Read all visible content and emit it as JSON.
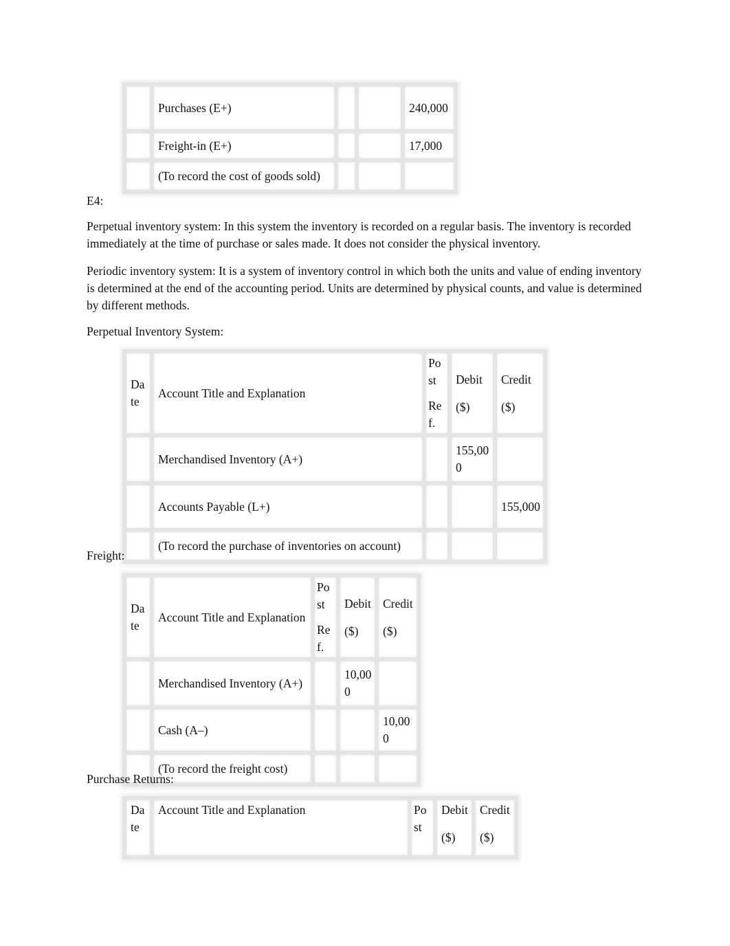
{
  "table_top": {
    "rows": [
      {
        "date": "",
        "account": "Purchases (E+)",
        "post_ref": "",
        "debit": "",
        "credit": "240,000"
      },
      {
        "date": "",
        "account": "Freight-in (E+)",
        "post_ref": "",
        "debit": "",
        "credit": "17,000"
      },
      {
        "date": "",
        "account": "(To record the cost of goods sold)",
        "post_ref": "",
        "debit": "",
        "credit": ""
      }
    ]
  },
  "e4_label": "E4:",
  "para_perpetual": "Perpetual inventory system: In this system the inventory is recorded on a regular basis. The inventory is recorded immediately at the time of purchase or sales made. It does not consider the physical inventory.",
  "para_periodic": "Periodic inventory system: It is a system of inventory control in which both the units and value of ending inventory is determined at the end of the accounting period. Units are determined by physical counts, and value is determined by different methods.",
  "perpetual_heading": "Perpetual Inventory System:",
  "headers": {
    "date": "Date",
    "account": "Account Title and Explanation",
    "post_ref_1": "Post",
    "post_ref_2": "Ref.",
    "debit_1": "Debit",
    "debit_2": "($)",
    "credit_1": "Credit",
    "credit_2": "($)"
  },
  "table_perpetual": {
    "rows": [
      {
        "date": "",
        "account": "Merchandised Inventory (A+)",
        "post_ref": "",
        "debit": "155,000",
        "credit": ""
      },
      {
        "date": "",
        "account": "Accounts Payable (L+)",
        "post_ref": "",
        "debit": "",
        "credit": "155,000"
      },
      {
        "date": "",
        "account": "(To record the purchase of inventories on account)",
        "post_ref": "",
        "debit": "",
        "credit": ""
      }
    ]
  },
  "freight_heading": "Freight:",
  "table_freight": {
    "rows": [
      {
        "date": "",
        "account": "Merchandised Inventory (A+)",
        "post_ref": "",
        "debit": "10,000",
        "credit": ""
      },
      {
        "date": "",
        "account": "Cash (A–)",
        "post_ref": "",
        "debit": "",
        "credit": "10,000"
      },
      {
        "date": "",
        "account": "(To record the freight cost)",
        "post_ref": "",
        "debit": "",
        "credit": ""
      }
    ]
  },
  "purchase_returns_heading": "Purchase Returns:"
}
